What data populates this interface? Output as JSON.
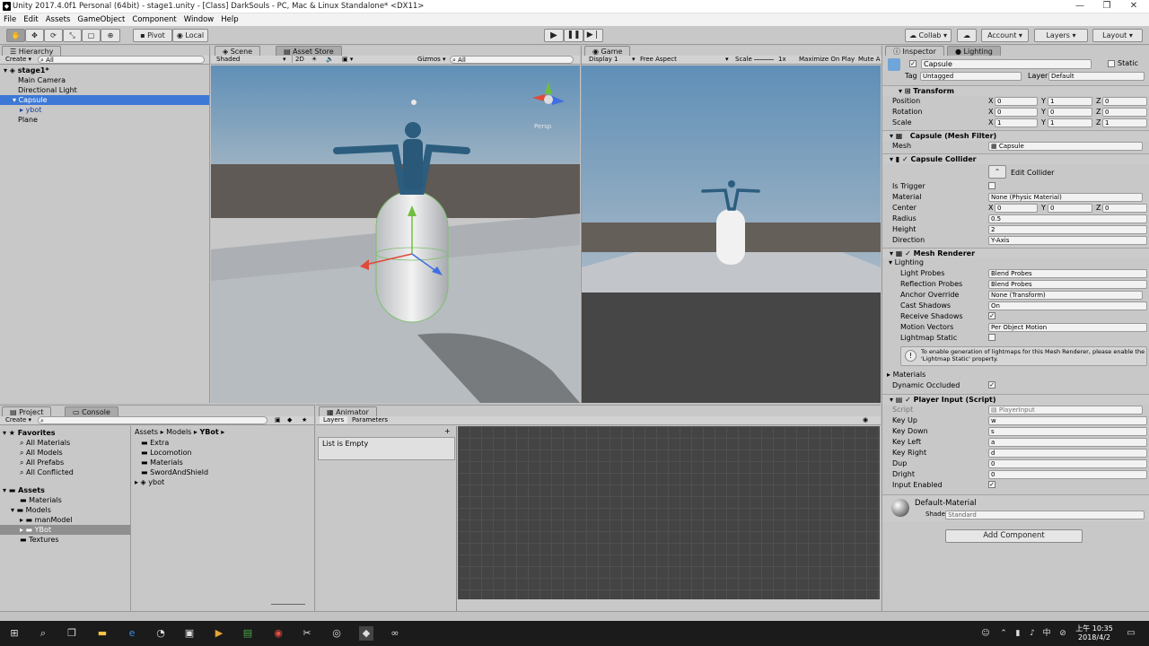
{
  "window": {
    "title": "Unity 2017.4.0f1 Personal (64bit) - stage1.unity - [Class] DarkSouls - PC, Mac & Linux Standalone* <DX11>"
  },
  "menu": [
    "File",
    "Edit",
    "Assets",
    "GameObject",
    "Component",
    "Window",
    "Help"
  ],
  "toolbar": {
    "pivot": "Pivot",
    "local": "Local",
    "collab": "Collab",
    "account": "Account",
    "layers": "Layers",
    "layout": "Layout"
  },
  "hierarchy": {
    "tab": "Hierarchy",
    "create": "Create",
    "search": "All",
    "scene": "stage1*",
    "items": [
      "Main Camera",
      "Directional Light",
      "Capsule",
      "ybot",
      "Plane"
    ]
  },
  "scene": {
    "tab": "Scene",
    "asset_tab": "Asset Store",
    "shaded": "Shaded",
    "mode2d": "2D",
    "gizmos": "Gizmos",
    "search": "All",
    "persp": "Persp"
  },
  "game": {
    "tab": "Game",
    "display": "Display 1",
    "aspect": "Free Aspect",
    "scale_label": "Scale",
    "scale": "1x",
    "maximize": "Maximize On Play",
    "mute": "Mute A"
  },
  "inspector": {
    "tab": "Inspector",
    "lighting_tab": "Lighting",
    "name": "Capsule",
    "static": "Static",
    "tag_label": "Tag",
    "tag": "Untagged",
    "layer_label": "Layer",
    "layer": "Default",
    "transform": {
      "title": "Transform",
      "rows": [
        {
          "label": "Position",
          "x": "0",
          "y": "1",
          "z": "0"
        },
        {
          "label": "Rotation",
          "x": "0",
          "y": "0",
          "z": "0"
        },
        {
          "label": "Scale",
          "x": "1",
          "y": "1",
          "z": "1"
        }
      ]
    },
    "mesh_filter": {
      "title": "Capsule (Mesh Filter)",
      "mesh_label": "Mesh",
      "mesh": "Capsule"
    },
    "collider": {
      "title": "Capsule Collider",
      "edit": "Edit Collider",
      "is_trigger": "Is Trigger",
      "material_label": "Material",
      "material": "None (Physic Material)",
      "center": "Center",
      "cx": "0",
      "cy": "0",
      "cz": "0",
      "radius_label": "Radius",
      "radius": "0.5",
      "height_label": "Height",
      "height": "2",
      "direction_label": "Direction",
      "direction": "Y-Axis"
    },
    "renderer": {
      "title": "Mesh Renderer",
      "lighting": "Lighting",
      "light_probes": "Light Probes",
      "light_probes_v": "Blend Probes",
      "refl": "Reflection Probes",
      "refl_v": "Blend Probes",
      "anchor": "Anchor Override",
      "anchor_v": "None (Transform)",
      "cast": "Cast Shadows",
      "cast_v": "On",
      "receive": "Receive Shadows",
      "motion": "Motion Vectors",
      "motion_v": "Per Object Motion",
      "lightmap": "Lightmap Static",
      "note": "To enable generation of lightmaps for this Mesh Renderer, please enable the 'Lightmap Static' property.",
      "materials": "Materials",
      "dyn": "Dynamic Occluded"
    },
    "player_input": {
      "title": "Player Input (Script)",
      "script_label": "Script",
      "script": "PlayerInput",
      "rows": [
        {
          "label": "Key Up",
          "value": "w"
        },
        {
          "label": "Key Down",
          "value": "s"
        },
        {
          "label": "Key Left",
          "value": "a"
        },
        {
          "label": "Key Right",
          "value": "d"
        },
        {
          "label": "Dup",
          "value": "0"
        },
        {
          "label": "Dright",
          "value": "0"
        }
      ],
      "enabled": "Input Enabled"
    },
    "material": {
      "name": "Default-Material",
      "shader_label": "Shader",
      "shader": "Standard"
    },
    "add_component": "Add Component"
  },
  "project": {
    "tab": "Project",
    "console_tab": "Console",
    "create": "Create",
    "favorites": "Favorites",
    "fav_items": [
      "All Materials",
      "All Models",
      "All Prefabs",
      "All Conflicted"
    ],
    "assets": "Assets",
    "tree": [
      "Materials",
      "Models",
      "manModel",
      "YBot",
      "Textures"
    ],
    "breadcrumb": [
      "Assets",
      "Models",
      "YBot"
    ],
    "files": [
      "Extra",
      "Locomotion",
      "Materials",
      "SwordAndShield",
      "ybot"
    ]
  },
  "animator": {
    "tab": "Animator",
    "layers": "Layers",
    "parameters": "Parameters",
    "empty": "List is Empty"
  },
  "clock": {
    "time": "上午 10:35",
    "date": "2018/4/2"
  }
}
